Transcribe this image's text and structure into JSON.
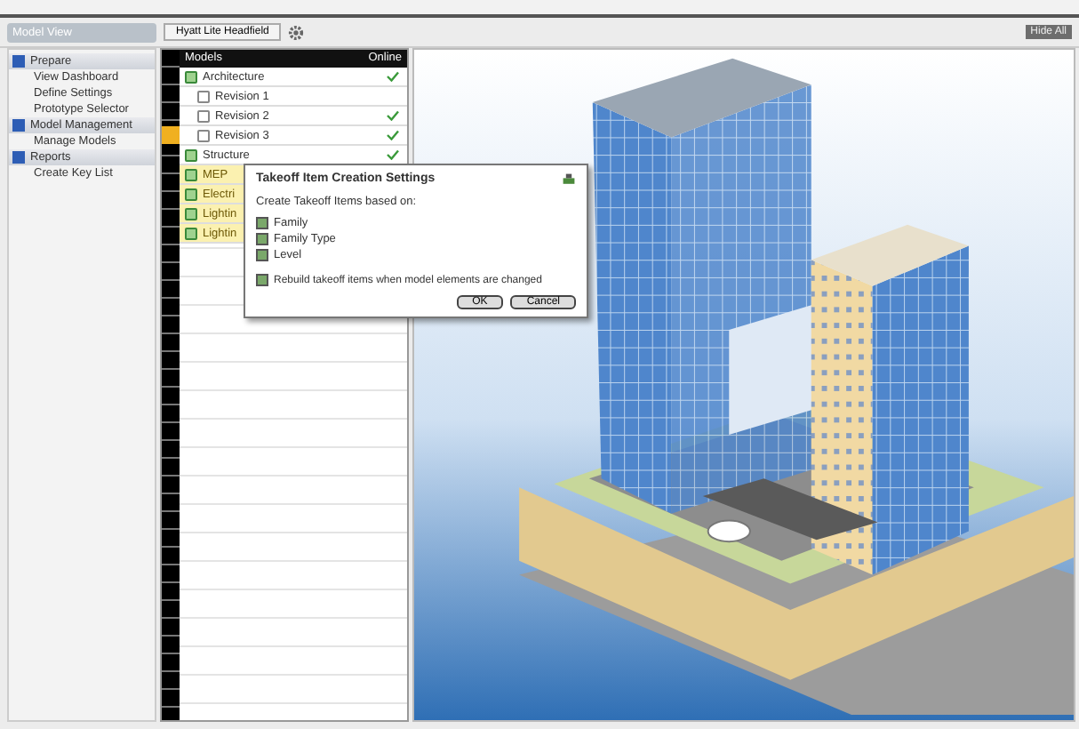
{
  "sidebar": {
    "header": "Model View",
    "sections": [
      {
        "title": "Prepare",
        "items": [
          "View Dashboard",
          "Define Settings",
          "Prototype Selector"
        ]
      },
      {
        "title": "Model Management",
        "items": [
          "Manage Models"
        ]
      },
      {
        "title": "Reports",
        "items": [
          "Create Key List"
        ]
      }
    ]
  },
  "tab": {
    "label": "Hyatt Lite Headfield"
  },
  "top_button": "Hide All",
  "grid": {
    "columns": [
      "Models",
      "Online"
    ],
    "rows": [
      {
        "name": "Architecture",
        "online": true,
        "selected": false,
        "highlighted": false,
        "children": [
          {
            "name": "Revision 1",
            "online": false,
            "selected": false,
            "highlighted": false
          },
          {
            "name": "Revision 2",
            "online": true,
            "selected": false,
            "highlighted": false
          },
          {
            "name": "Revision 3",
            "online": true,
            "selected": true,
            "highlighted": false
          }
        ]
      },
      {
        "name": "Structure",
        "online": true,
        "selected": false,
        "highlighted": false
      },
      {
        "name": "MEP",
        "selected": false,
        "highlighted": true
      },
      {
        "name": "Electri",
        "selected": false,
        "highlighted": true
      },
      {
        "name": "Lightin",
        "selected": false,
        "highlighted": true
      },
      {
        "name": "Lightin",
        "selected": false,
        "highlighted": true
      }
    ]
  },
  "dialog": {
    "title": "Takeoff Item Creation Settings",
    "prompt": "Create Takeoff Items based on:",
    "options": [
      {
        "label": "Family",
        "checked": true
      },
      {
        "label": "Family Type",
        "checked": true
      },
      {
        "label": "Level",
        "checked": true
      }
    ],
    "rebuild": {
      "label": "Rebuild takeoff items when model elements are changed",
      "checked": true
    },
    "buttons": [
      "OK",
      "Cancel"
    ]
  }
}
